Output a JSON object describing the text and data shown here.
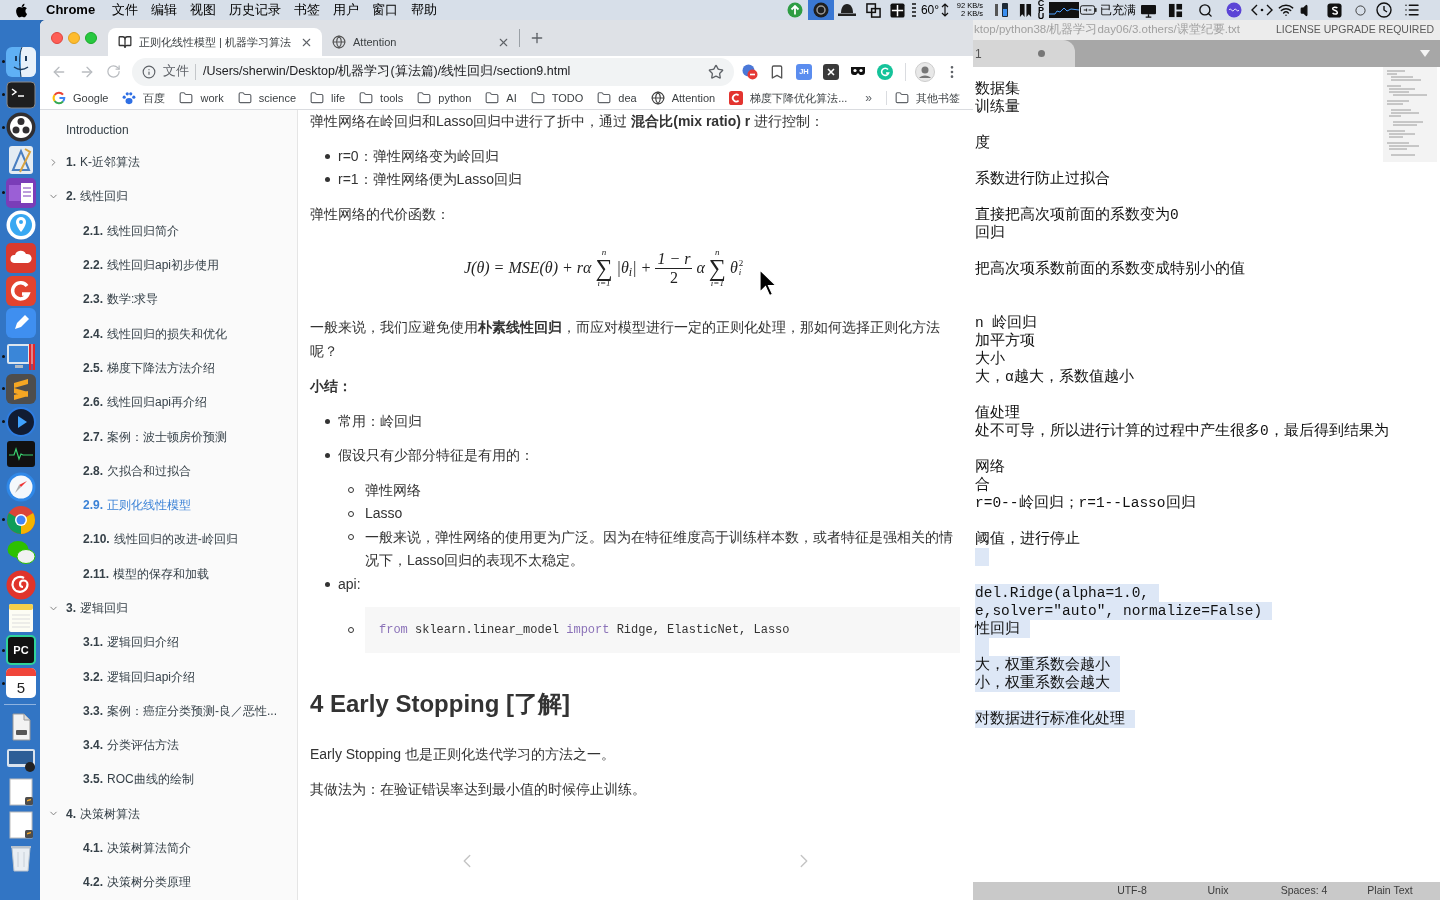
{
  "menu_bar": {
    "app_name": "Chrome",
    "menus": [
      "文件",
      "编辑",
      "视图",
      "历史记录",
      "书签",
      "用户",
      "窗口",
      "帮助"
    ],
    "status_items": [
      {
        "kind": "upload",
        "selected": false
      },
      {
        "kind": "app",
        "selected": true
      },
      {
        "kind": "hat",
        "selected": false
      },
      {
        "kind": "windows",
        "selected": false
      },
      {
        "kind": "grid",
        "selected": false
      },
      {
        "kind": "sensor",
        "selected": false
      },
      {
        "kind": "temperature",
        "text": "60°",
        "selected": false
      },
      {
        "kind": "arrows",
        "selected": false
      },
      {
        "kind": "network",
        "lines": [
          "92 KB/s",
          "2 KB/s"
        ],
        "selected": false
      },
      {
        "kind": "memory",
        "selected": false
      },
      {
        "kind": "bars",
        "selected": false
      },
      {
        "kind": "cpu",
        "text": "CPU",
        "selected": false
      },
      {
        "kind": "graph",
        "selected": false
      },
      {
        "kind": "battery",
        "text": "已充满",
        "selected": false
      },
      {
        "kind": "display",
        "selected": false
      },
      {
        "kind": "layout",
        "selected": false
      },
      {
        "kind": "search",
        "selected": false
      },
      {
        "kind": "siri",
        "selected": false
      },
      {
        "kind": "code",
        "selected": false
      },
      {
        "kind": "wifi",
        "selected": false
      },
      {
        "kind": "volume",
        "selected": false
      },
      {
        "kind": "input",
        "selected": false
      },
      {
        "kind": "circle",
        "selected": false
      },
      {
        "kind": "clock",
        "selected": false
      },
      {
        "kind": "list",
        "selected": false
      }
    ]
  },
  "dock": {
    "apps": [
      {
        "kind": "finder",
        "running": true
      },
      {
        "kind": "terminal",
        "running": true
      },
      {
        "kind": "obs",
        "running": true
      },
      {
        "kind": "drafting",
        "running": false
      },
      {
        "kind": "notebook",
        "running": true
      },
      {
        "kind": "location",
        "running": false
      },
      {
        "kind": "cloud",
        "running": false
      },
      {
        "kind": "arc",
        "running": false
      },
      {
        "kind": "pencil",
        "running": false
      },
      {
        "kind": "monitor",
        "running": true
      },
      {
        "kind": "stripes",
        "running": true
      },
      {
        "kind": "play",
        "running": true
      },
      {
        "kind": "chart",
        "running": false
      },
      {
        "kind": "compass",
        "running": false
      },
      {
        "kind": "wheel",
        "running": true
      },
      {
        "kind": "chat",
        "running": false
      },
      {
        "kind": "swirl",
        "running": false
      },
      {
        "kind": "notepad",
        "running": false
      },
      {
        "kind": "letters",
        "label": "PC",
        "running": true
      },
      {
        "kind": "calendar",
        "day": "5",
        "running": true
      }
    ],
    "stacks": [
      {
        "kind": "document"
      },
      {
        "kind": "screenshot"
      },
      {
        "kind": "sheet"
      },
      {
        "kind": "sheet"
      },
      {
        "kind": "trash"
      }
    ]
  },
  "browser": {
    "tabs": [
      {
        "kind": "book",
        "title": "正则化线性模型 | 机器学习算法",
        "selected": true
      },
      {
        "kind": "globe",
        "title": "Attention",
        "selected": false
      }
    ],
    "address_bar": {
      "scheme_label": "文件",
      "url": "/Users/sherwin/Desktop/机器学习(算法篇)/线性回归/section9.html"
    },
    "extensions": [
      {
        "kind": "circles"
      },
      {
        "kind": "bookmark"
      },
      {
        "kind": "letters",
        "label": "JH"
      },
      {
        "kind": "x"
      },
      {
        "kind": "mask"
      },
      {
        "kind": "arc"
      }
    ],
    "bookmarks": [
      {
        "kind": "g_logo",
        "label": "Google"
      },
      {
        "kind": "paw",
        "label": "百度"
      },
      {
        "kind": "folder",
        "label": "work"
      },
      {
        "kind": "folder",
        "label": "science"
      },
      {
        "kind": "folder",
        "label": "life"
      },
      {
        "kind": "folder",
        "label": "tools"
      },
      {
        "kind": "folder",
        "label": "python"
      },
      {
        "kind": "folder",
        "label": "AI"
      },
      {
        "kind": "folder",
        "label": "TODO"
      },
      {
        "kind": "folder",
        "label": "dea"
      },
      {
        "kind": "globe",
        "label": "Attention"
      },
      {
        "kind": "c_logo",
        "label": "梯度下降优化算法..."
      }
    ],
    "bookmarks_overflow": "»",
    "other_bookmarks": {
      "kind": "folder",
      "label": "其他书签"
    }
  },
  "sidebar": {
    "items": [
      {
        "title": "Introduction",
        "selected": false
      },
      {
        "number": "1.",
        "title": "K-近邻算法",
        "expanded": false,
        "selected": false
      },
      {
        "number": "2.",
        "title": "线性回归",
        "expanded": true,
        "selected": false,
        "children": [
          {
            "number": "2.1.",
            "title": "线性回归简介",
            "selected": false
          },
          {
            "number": "2.2.",
            "title": "线性回归api初步使用",
            "selected": false
          },
          {
            "number": "2.3.",
            "title": "数学:求导",
            "selected": false
          },
          {
            "number": "2.4.",
            "title": "线性回归的损失和优化",
            "selected": false
          },
          {
            "number": "2.5.",
            "title": "梯度下降法方法介绍",
            "selected": false
          },
          {
            "number": "2.6.",
            "title": "线性回归api再介绍",
            "selected": false
          },
          {
            "number": "2.7.",
            "title": "案例：波士顿房价预测",
            "selected": false
          },
          {
            "number": "2.8.",
            "title": "欠拟合和过拟合",
            "selected": false
          },
          {
            "number": "2.9.",
            "title": "正则化线性模型",
            "selected": true
          },
          {
            "number": "2.10.",
            "title": "线性回归的改进-岭回归",
            "selected": false
          },
          {
            "number": "2.11.",
            "title": "模型的保存和加载",
            "selected": false
          }
        ]
      },
      {
        "number": "3.",
        "title": "逻辑回归",
        "expanded": true,
        "selected": false,
        "children": [
          {
            "number": "3.1.",
            "title": "逻辑回归介绍",
            "selected": false
          },
          {
            "number": "3.2.",
            "title": "逻辑回归api介绍",
            "selected": false
          },
          {
            "number": "3.3.",
            "title": "案例：癌症分类预测-良／恶性...",
            "selected": false
          },
          {
            "number": "3.4.",
            "title": "分类评估方法",
            "selected": false
          },
          {
            "number": "3.5.",
            "title": "ROC曲线的绘制",
            "selected": false
          }
        ]
      },
      {
        "number": "4.",
        "title": "决策树算法",
        "expanded": true,
        "selected": false,
        "children": [
          {
            "number": "4.1.",
            "title": "决策树算法简介",
            "selected": false
          },
          {
            "number": "4.2.",
            "title": "决策树分类原理",
            "selected": false
          }
        ]
      }
    ]
  },
  "article": {
    "blocks": [
      {
        "kind": "paragraph",
        "text": "弹性网络在岭回归和Lasso回归中进行了折中，通过 **混合比(mix ratio) r** 进行控制："
      },
      {
        "kind": "list",
        "items": [
          {
            "text": "r=0：弹性网络变为岭回归"
          },
          {
            "text": "r=1：弹性网络便为Lasso回归"
          }
        ]
      },
      {
        "kind": "paragraph",
        "text": "弹性网络的代价函数："
      },
      {
        "kind": "formula",
        "parts": [
          {
            "kind": "text",
            "text": "J(θ) = MSE(θ) + rα"
          },
          {
            "kind": "sum",
            "symbol": "∑",
            "upper": "n",
            "lower": "i=1"
          },
          {
            "kind": "text",
            "text": "|θ$_{i}$| +"
          },
          {
            "kind": "frac",
            "numerator": "1 − r",
            "denominator": "2"
          },
          {
            "kind": "text",
            "text": "α"
          },
          {
            "kind": "sum",
            "symbol": "∑",
            "upper": "n",
            "lower": "i=1"
          },
          {
            "kind": "script",
            "base": "θ",
            "sub": "i",
            "sup": "2"
          }
        ]
      },
      {
        "kind": "paragraph",
        "text": "一般来说，我们应避免使用**朴素线性回归**，而应对模型进行一定的正则化处理，那如何选择正则化方法呢？"
      },
      {
        "kind": "summary",
        "text": "小结："
      },
      {
        "kind": "loose_list",
        "items": [
          {
            "text": "常用：岭回归"
          },
          {
            "text": "假设只有少部分特征是有用的：",
            "children": [
              {
                "kind": "text",
                "text": "弹性网络"
              },
              {
                "kind": "text",
                "text": "Lasso"
              },
              {
                "kind": "text",
                "text": "一般来说，弹性网络的使用更为广泛。因为在特征维度高于训练样本数，或者特征是强相关的情况下，Lasso回归的表现不太稳定。"
              }
            ]
          },
          {
            "text": "api:",
            "children": [
              {
                "kind": "code",
                "tokens": [
                  {
                    "kind": "keyword",
                    "text": "from"
                  },
                  {
                    "kind": "plain",
                    "text": " sklearn.linear_model "
                  },
                  {
                    "kind": "keyword",
                    "text": "import"
                  },
                  {
                    "kind": "plain",
                    "text": " Ridge, ElasticNet, Lasso"
                  }
                ]
              }
            ]
          }
        ]
      },
      {
        "kind": "heading",
        "text": "4 Early Stopping [了解]"
      },
      {
        "kind": "paragraph",
        "text": "Early Stopping 也是正则化迭代学习的方法之一。"
      },
      {
        "kind": "paragraph",
        "text": "其做法为：在验证错误率达到最小值的时候停止训练。"
      }
    ]
  },
  "editor": {
    "title": "ktop/python38/机器学习day06/3.others/课堂纪要.txt",
    "license": "LICENSE UPGRADE REQUIRED",
    "tab": {
      "label": "1",
      "modified": true
    },
    "lines": [
      {
        "kind": "text",
        "text": "数据集",
        "selected": false
      },
      {
        "kind": "text",
        "text": "训练量",
        "selected": false
      },
      {
        "kind": "blank",
        "selected": false
      },
      {
        "kind": "text",
        "text": "度",
        "selected": false
      },
      {
        "kind": "blank",
        "selected": false
      },
      {
        "kind": "text",
        "text": "系数进行防止过拟合",
        "selected": false
      },
      {
        "kind": "blank",
        "selected": false
      },
      {
        "kind": "text",
        "text": "直接把高次项前面的系数变为0",
        "selected": false
      },
      {
        "kind": "text",
        "text": "回归",
        "selected": false
      },
      {
        "kind": "blank",
        "selected": false
      },
      {
        "kind": "text",
        "text": "把高次项系数前面的系数变成特别小的值",
        "selected": false
      },
      {
        "kind": "blank",
        "selected": false
      },
      {
        "kind": "blank",
        "selected": false
      },
      {
        "kind": "text",
        "text": "n 岭回归",
        "selected": false
      },
      {
        "kind": "text",
        "text": "加平方项",
        "selected": false
      },
      {
        "kind": "text",
        "text": "大小",
        "selected": false
      },
      {
        "kind": "text",
        "text": "大，α越大，系数值越小",
        "selected": false
      },
      {
        "kind": "blank",
        "selected": false
      },
      {
        "kind": "text",
        "text": "值处理",
        "selected": false
      },
      {
        "kind": "text",
        "text": "处不可导，所以进行计算的过程中产生很多0，最后得到结果为",
        "selected": false
      },
      {
        "kind": "blank",
        "selected": false
      },
      {
        "kind": "text",
        "text": "网络",
        "selected": false
      },
      {
        "kind": "text",
        "text": "合",
        "selected": false
      },
      {
        "kind": "text",
        "text": "r=0--岭回归；r=1--Lasso回归",
        "selected": false
      },
      {
        "kind": "blank",
        "selected": false
      },
      {
        "kind": "text",
        "text": "阈值，进行停止",
        "selected": false
      },
      {
        "kind": "blank",
        "selected": true
      },
      {
        "kind": "blank",
        "selected": false
      },
      {
        "kind": "text",
        "text": "del.Ridge(alpha=1.0,",
        "selected": true
      },
      {
        "kind": "text",
        "text": "e,solver=\"auto\", normalize=False)",
        "selected": true
      },
      {
        "kind": "text",
        "text": "性回归",
        "selected": true
      },
      {
        "kind": "blank",
        "selected": true
      },
      {
        "kind": "text",
        "text": "大，权重系数会越小",
        "selected": true
      },
      {
        "kind": "text",
        "text": "小，权重系数会越大",
        "selected": true
      },
      {
        "kind": "blank",
        "selected": false
      },
      {
        "kind": "text",
        "text": "对数据进行标准化处理",
        "selected": true
      }
    ],
    "status": [
      "UTF-8",
      "Unix",
      "Spaces: 4",
      "Plain Text"
    ]
  }
}
